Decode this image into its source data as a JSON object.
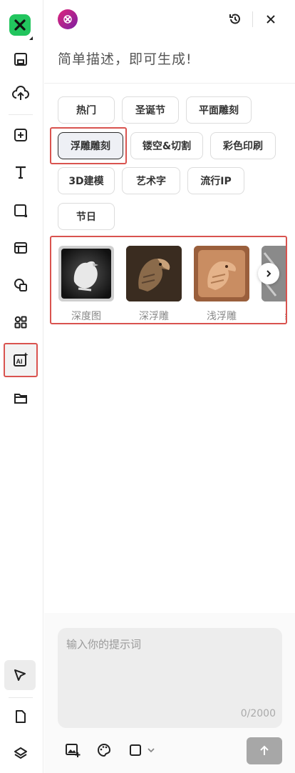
{
  "header": {
    "title": "简单描述，即可生成!"
  },
  "chips": [
    {
      "label": "热门",
      "selected": false
    },
    {
      "label": "圣诞节",
      "selected": false
    },
    {
      "label": "平面雕刻",
      "selected": false
    },
    {
      "label": "浮雕雕刻",
      "selected": true
    },
    {
      "label": "镂空&切割",
      "selected": false
    },
    {
      "label": "彩色印刷",
      "selected": false
    },
    {
      "label": "3D建模",
      "selected": false
    },
    {
      "label": "艺术字",
      "selected": false
    },
    {
      "label": "流行IP",
      "selected": false
    },
    {
      "label": "节日",
      "selected": false
    }
  ],
  "gallery": [
    {
      "label": "深度图"
    },
    {
      "label": "深浮雕"
    },
    {
      "label": "浅浮雕"
    },
    {
      "label": "纟"
    }
  ],
  "prompt": {
    "placeholder": "输入你的提示词",
    "counter": "0/2000"
  },
  "colors": {
    "accent": "#22c55e",
    "highlight": "#d9534f",
    "send": "#a7a7a7"
  }
}
